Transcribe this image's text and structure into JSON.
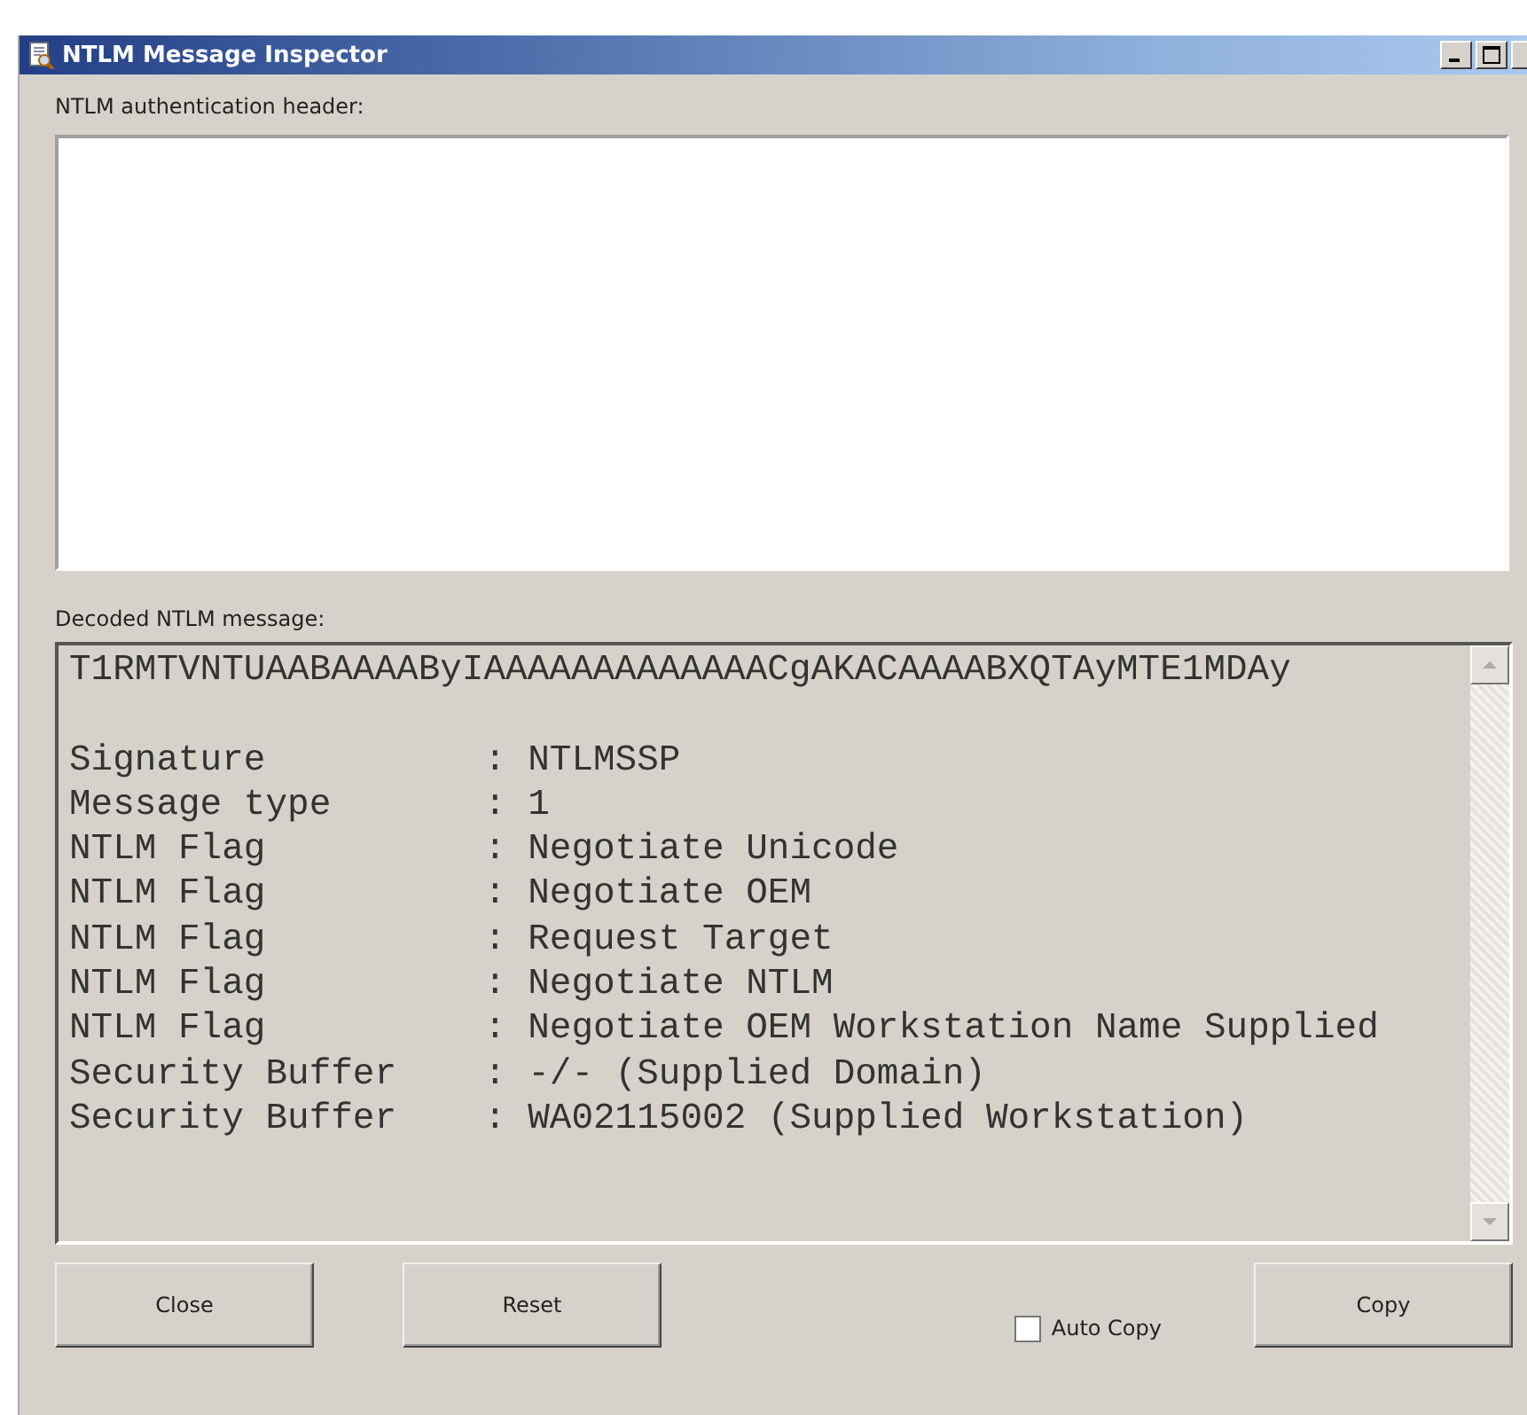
{
  "window": {
    "title": "NTLM Message Inspector"
  },
  "header_field": {
    "label": "NTLM authentication header:"
  },
  "decoded": {
    "label": "Decoded NTLM message:",
    "raw": "T1RMTVNTUAABAAAAByIAAAAAAAAAAAAACgAKACAAAABXQTAyMTE1MDAy",
    "rows": [
      {
        "field": "Signature",
        "value": ": NTLMSSP"
      },
      {
        "field": "Message type",
        "value": ": 1"
      },
      {
        "field": "NTLM Flag",
        "value": ": Negotiate Unicode"
      },
      {
        "field": "NTLM Flag",
        "value": ": Negotiate OEM"
      },
      {
        "field": "NTLM Flag",
        "value": ": Request Target"
      },
      {
        "field": "NTLM Flag",
        "value": ": Negotiate NTLM"
      },
      {
        "field": "NTLM Flag",
        "value": ": Negotiate OEM Workstation Name Supplied"
      },
      {
        "field": "Security Buffer",
        "value": ": -/- (Supplied Domain)"
      },
      {
        "field": "Security Buffer",
        "value": ": WA02115002 (Supplied Workstation)"
      }
    ]
  },
  "buttons": [
    {
      "label": "Close"
    },
    {
      "label": "Reset"
    }
  ],
  "auto_copy": {
    "label": "Auto Copy",
    "checked": false
  },
  "copy_button": {
    "label": "Copy"
  }
}
